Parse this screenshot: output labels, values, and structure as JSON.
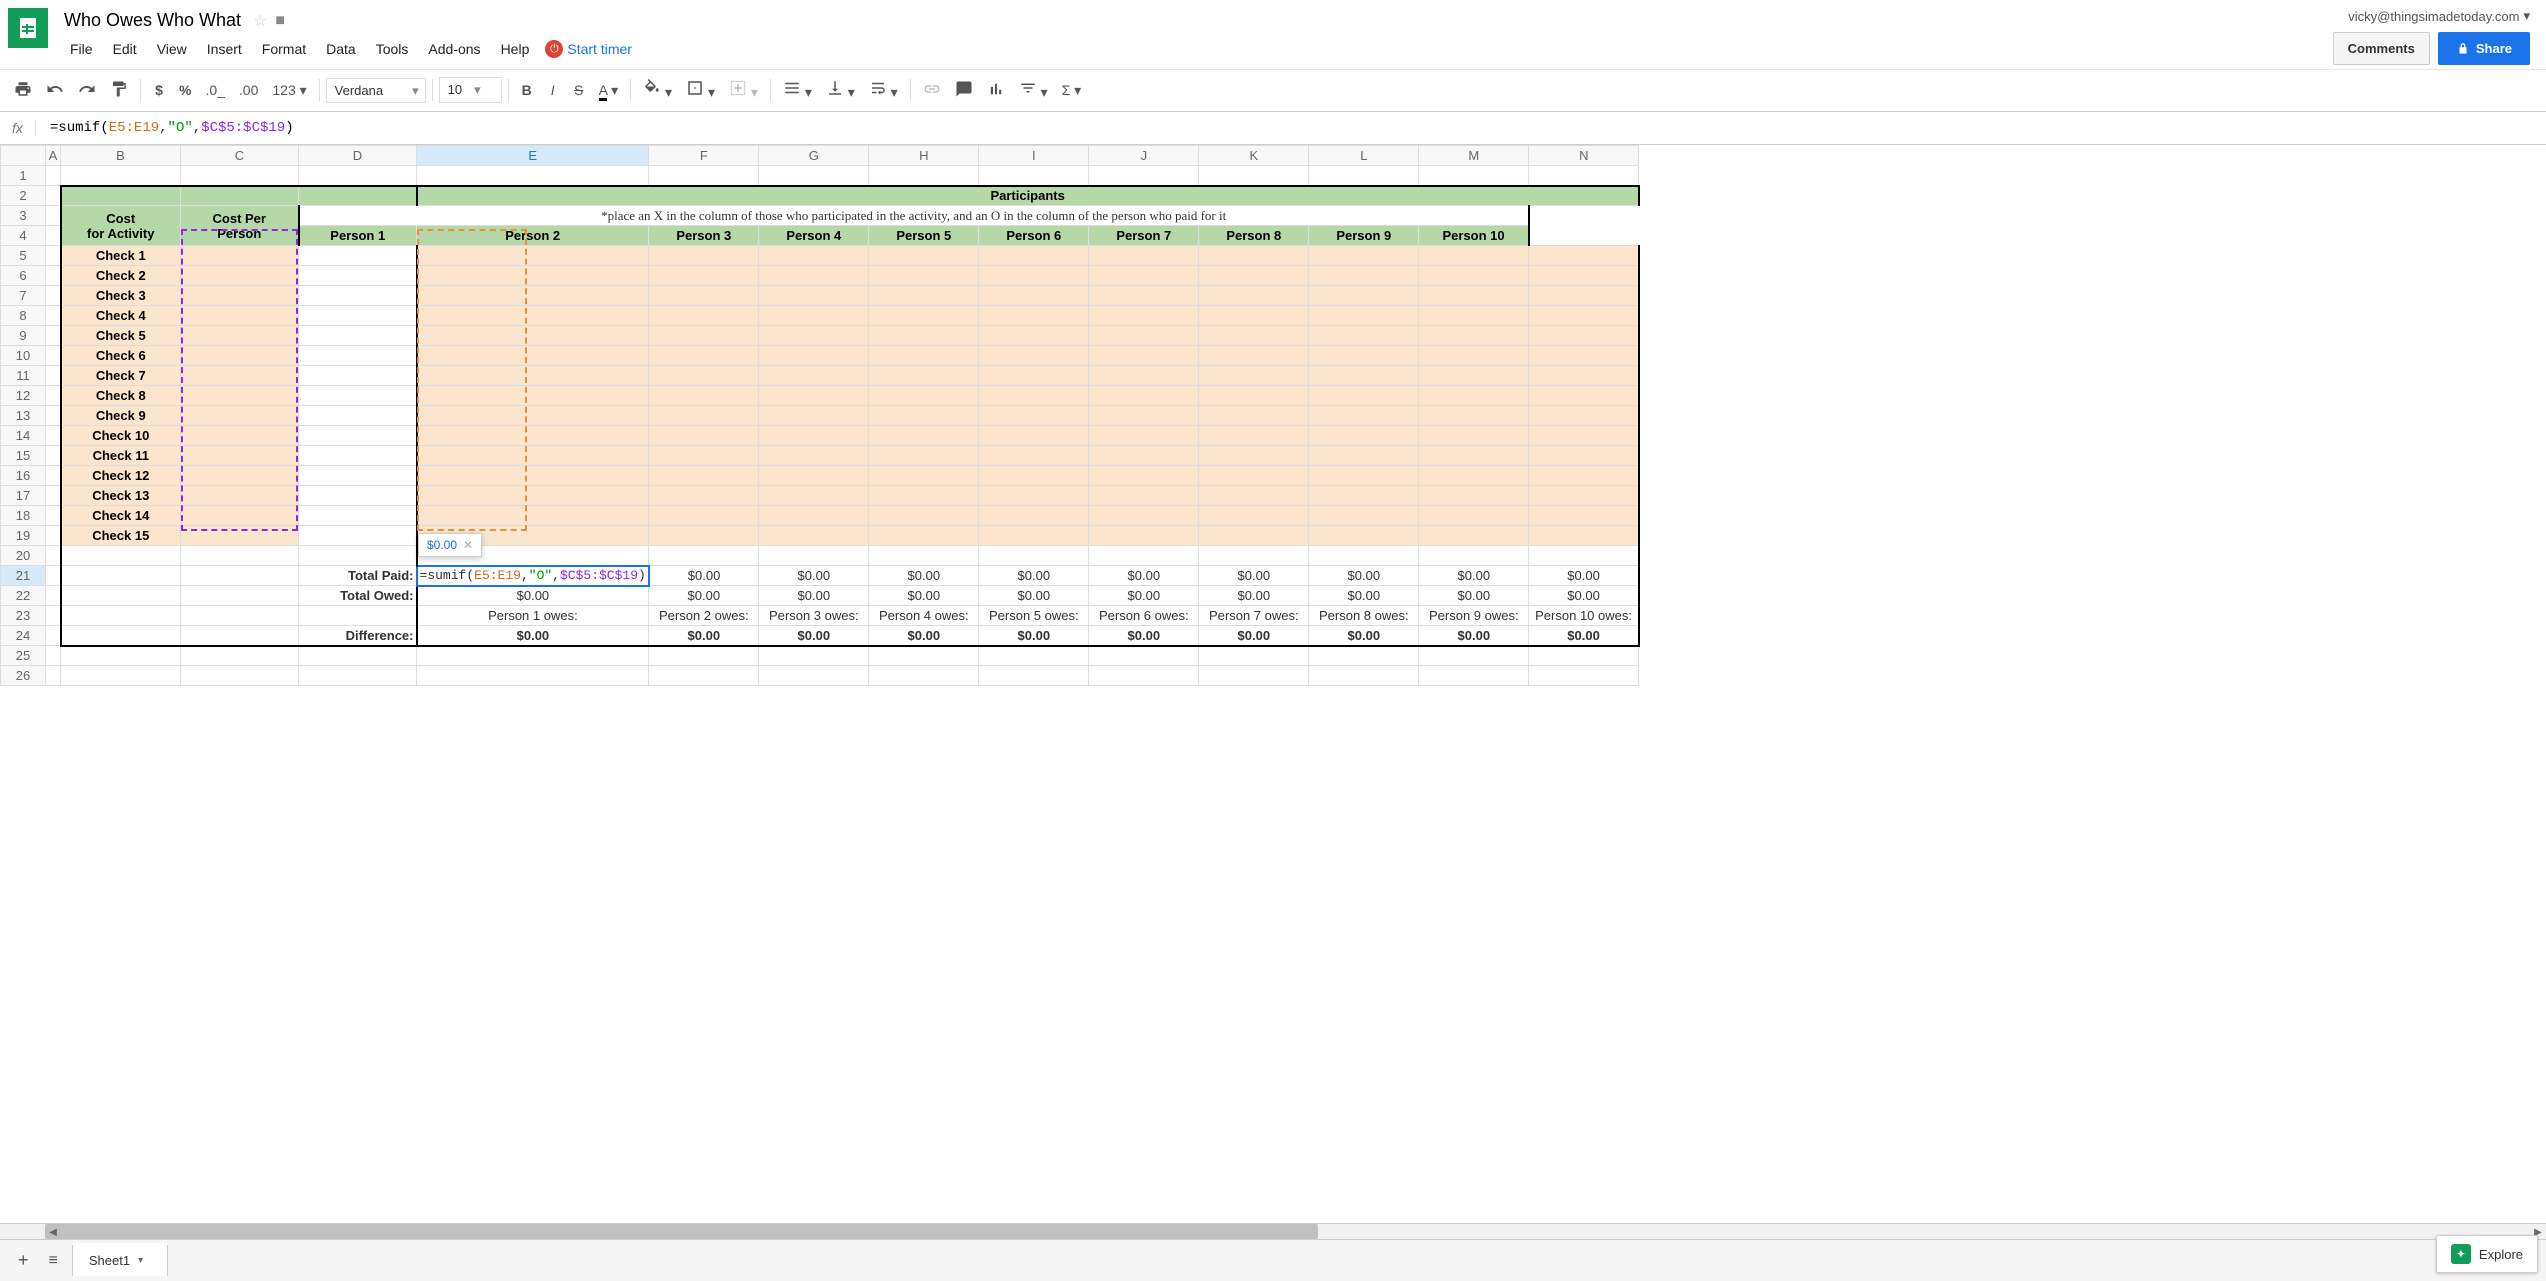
{
  "doc": {
    "title": "Who Owes Who What",
    "user": "vicky@thingsimadetoday.com"
  },
  "menu": {
    "file": "File",
    "edit": "Edit",
    "view": "View",
    "insert": "Insert",
    "format": "Format",
    "data": "Data",
    "tools": "Tools",
    "addons": "Add-ons",
    "help": "Help",
    "start_timer": "Start timer"
  },
  "header_buttons": {
    "comments": "Comments",
    "share": "Share"
  },
  "toolbar": {
    "font": "Verdana",
    "size": "10",
    "format_num": "123"
  },
  "formula": {
    "raw": "=sumif(E5:E19,\"O\",$C$5:$C$19)",
    "parts": {
      "eq": "=",
      "fn": "sumif",
      "p1": "(",
      "r1": "E5:E19",
      "c1": ",",
      "str": "\"O\"",
      "c2": ",",
      "r2": "$C$5:$C$19",
      "p2": ")"
    }
  },
  "tooltip": {
    "value": "$0.00"
  },
  "columns": [
    "A",
    "B",
    "C",
    "D",
    "E",
    "F",
    "G",
    "H",
    "I",
    "J",
    "K",
    "L",
    "M",
    "N"
  ],
  "sheet": {
    "participants_header": "Participants",
    "hint": "*place an X in the column of those who participated in the activity, and an O in the column of the person who paid for it",
    "cost_for_activity": "Cost for Activity",
    "cost_per_person": "Cost Per Person",
    "persons": [
      "Person 1",
      "Person 2",
      "Person 3",
      "Person 4",
      "Person 5",
      "Person 6",
      "Person 7",
      "Person 8",
      "Person 9",
      "Person 10"
    ],
    "checks": [
      "Check 1",
      "Check 2",
      "Check 3",
      "Check 4",
      "Check 5",
      "Check 6",
      "Check 7",
      "Check 8",
      "Check 9",
      "Check 10",
      "Check 11",
      "Check 12",
      "Check 13",
      "Check 14",
      "Check 15"
    ],
    "total_paid": "Total Paid:",
    "total_owed": "Total Owed:",
    "difference": "Difference:",
    "zero": "$0.00",
    "owes": [
      "Person 1 owes:",
      "Person 2 owes:",
      "Person 3 owes:",
      "Person 4 owes:",
      "Person 5 owes:",
      "Person 6 owes:",
      "Person 7 owes:",
      "Person 8 owes:",
      "Person 9 owes:",
      "Person 10 owes:"
    ]
  },
  "tabs": {
    "sheet1": "Sheet1"
  },
  "explore": "Explore"
}
